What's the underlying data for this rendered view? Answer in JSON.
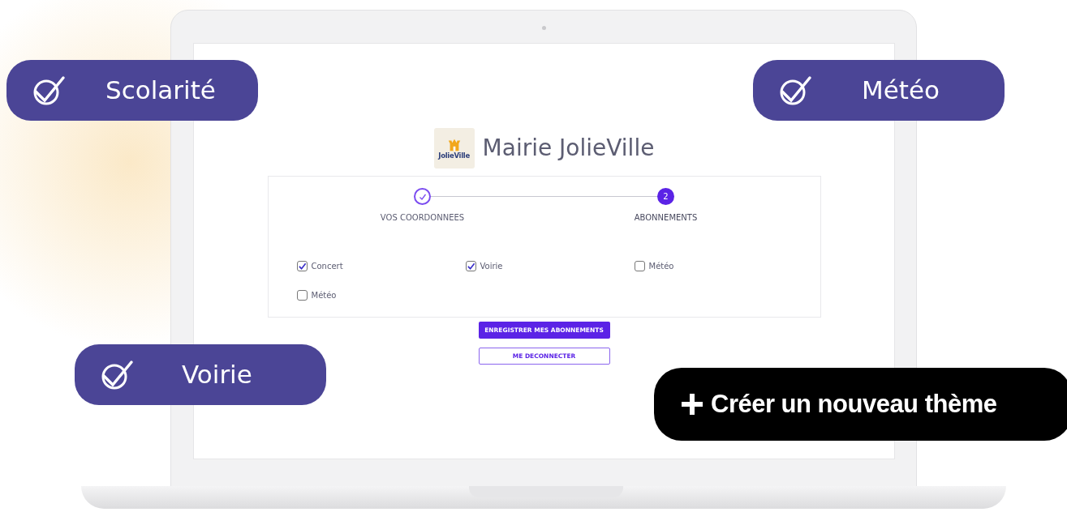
{
  "site": {
    "title": "Mairie JolieVille",
    "logo_text": "JolieVille"
  },
  "steps": [
    {
      "label": "VOS COORDONNEES",
      "done": true,
      "selected": false
    },
    {
      "number": "2",
      "label": "ABONNEMENTS",
      "done": false,
      "selected": true
    }
  ],
  "subscriptions": [
    {
      "label": "Concert",
      "checked": true
    },
    {
      "label": "Voirie",
      "checked": true
    },
    {
      "label": "Météo",
      "checked": false
    },
    {
      "label": "Météo",
      "checked": false
    }
  ],
  "buttons": [
    {
      "label": "ENREGISTRER MES ABONNEMENTS",
      "kind": "primary"
    },
    {
      "label": "ME DECONNECTER",
      "kind": "outline"
    }
  ],
  "badges": [
    {
      "label": "Scolarité"
    },
    {
      "label": "Météo"
    },
    {
      "label": "Voirie"
    }
  ],
  "create_button": {
    "label": "Créer un nouveau thème"
  }
}
